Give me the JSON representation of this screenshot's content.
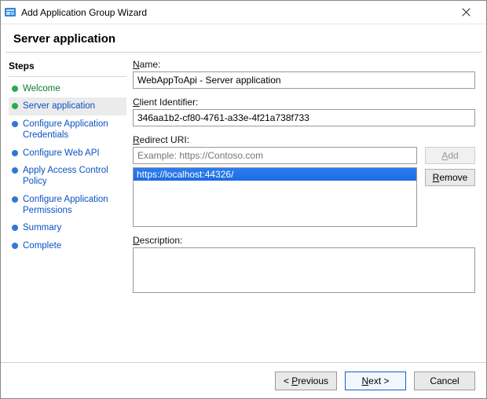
{
  "window": {
    "title": "Add Application Group Wizard"
  },
  "page": {
    "heading": "Server application"
  },
  "steps": {
    "heading": "Steps",
    "items": [
      {
        "label": "Welcome",
        "state": "completed"
      },
      {
        "label": "Server application",
        "state": "active"
      },
      {
        "label": "Configure Application Credentials",
        "state": "future"
      },
      {
        "label": "Configure Web API",
        "state": "future"
      },
      {
        "label": "Apply Access Control Policy",
        "state": "future"
      },
      {
        "label": "Configure Application Permissions",
        "state": "future"
      },
      {
        "label": "Summary",
        "state": "future"
      },
      {
        "label": "Complete",
        "state": "future"
      }
    ]
  },
  "form": {
    "name": {
      "label": "Name:",
      "value": "WebAppToApi - Server application"
    },
    "client_identifier": {
      "label": "Client Identifier:",
      "value": "346aa1b2-cf80-4761-a33e-4f21a738f733"
    },
    "redirect_uri": {
      "label": "Redirect URI:",
      "placeholder": "Example: https://Contoso.com",
      "list": [
        {
          "value": "https://localhost:44326/",
          "selected": true
        }
      ]
    },
    "description": {
      "label": "Description:",
      "value": ""
    }
  },
  "buttons": {
    "add": "Add",
    "remove": "Remove",
    "previous": "< Previous",
    "next": "Next >",
    "cancel": "Cancel"
  }
}
